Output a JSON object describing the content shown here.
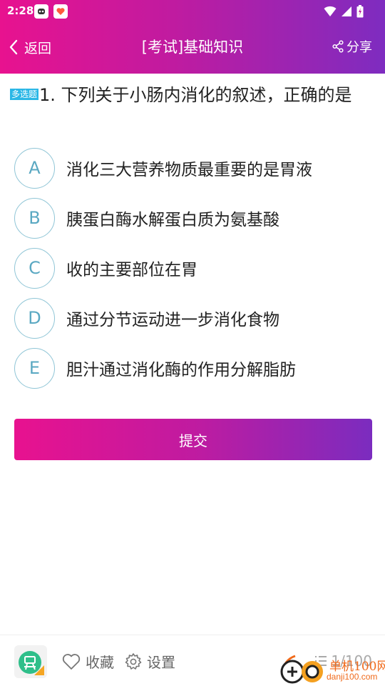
{
  "status_bar": {
    "time": "2:28"
  },
  "navbar": {
    "back_label": "返回",
    "title": "[考试]基础知识",
    "share_label": "分享"
  },
  "question": {
    "type_badge": "多选题",
    "text": "1. 下列关于小肠内消化的叙述，正确的是"
  },
  "options": [
    {
      "letter": "A",
      "text": "消化三大营养物质最重要的是胃液"
    },
    {
      "letter": "B",
      "text": "胰蛋白酶水解蛋白质为氨基酸"
    },
    {
      "letter": "C",
      "text": "收的主要部位在胃"
    },
    {
      "letter": "D",
      "text": "通过分节运动进一步消化食物"
    },
    {
      "letter": "E",
      "text": "胆汁通过消化酶的作用分解脂肪"
    }
  ],
  "submit_label": "提交",
  "bottom_bar": {
    "favorite_label": "收藏",
    "settings_label": "设置",
    "progress": "1/100"
  },
  "watermark": {
    "line1": "单机100网",
    "line2": "danji100.com"
  },
  "colors": {
    "header_gradient_start": "#e8128f",
    "header_gradient_end": "#7e2cc0",
    "option_circle": "#8fc5d6",
    "badge": "#2bb7e6"
  }
}
